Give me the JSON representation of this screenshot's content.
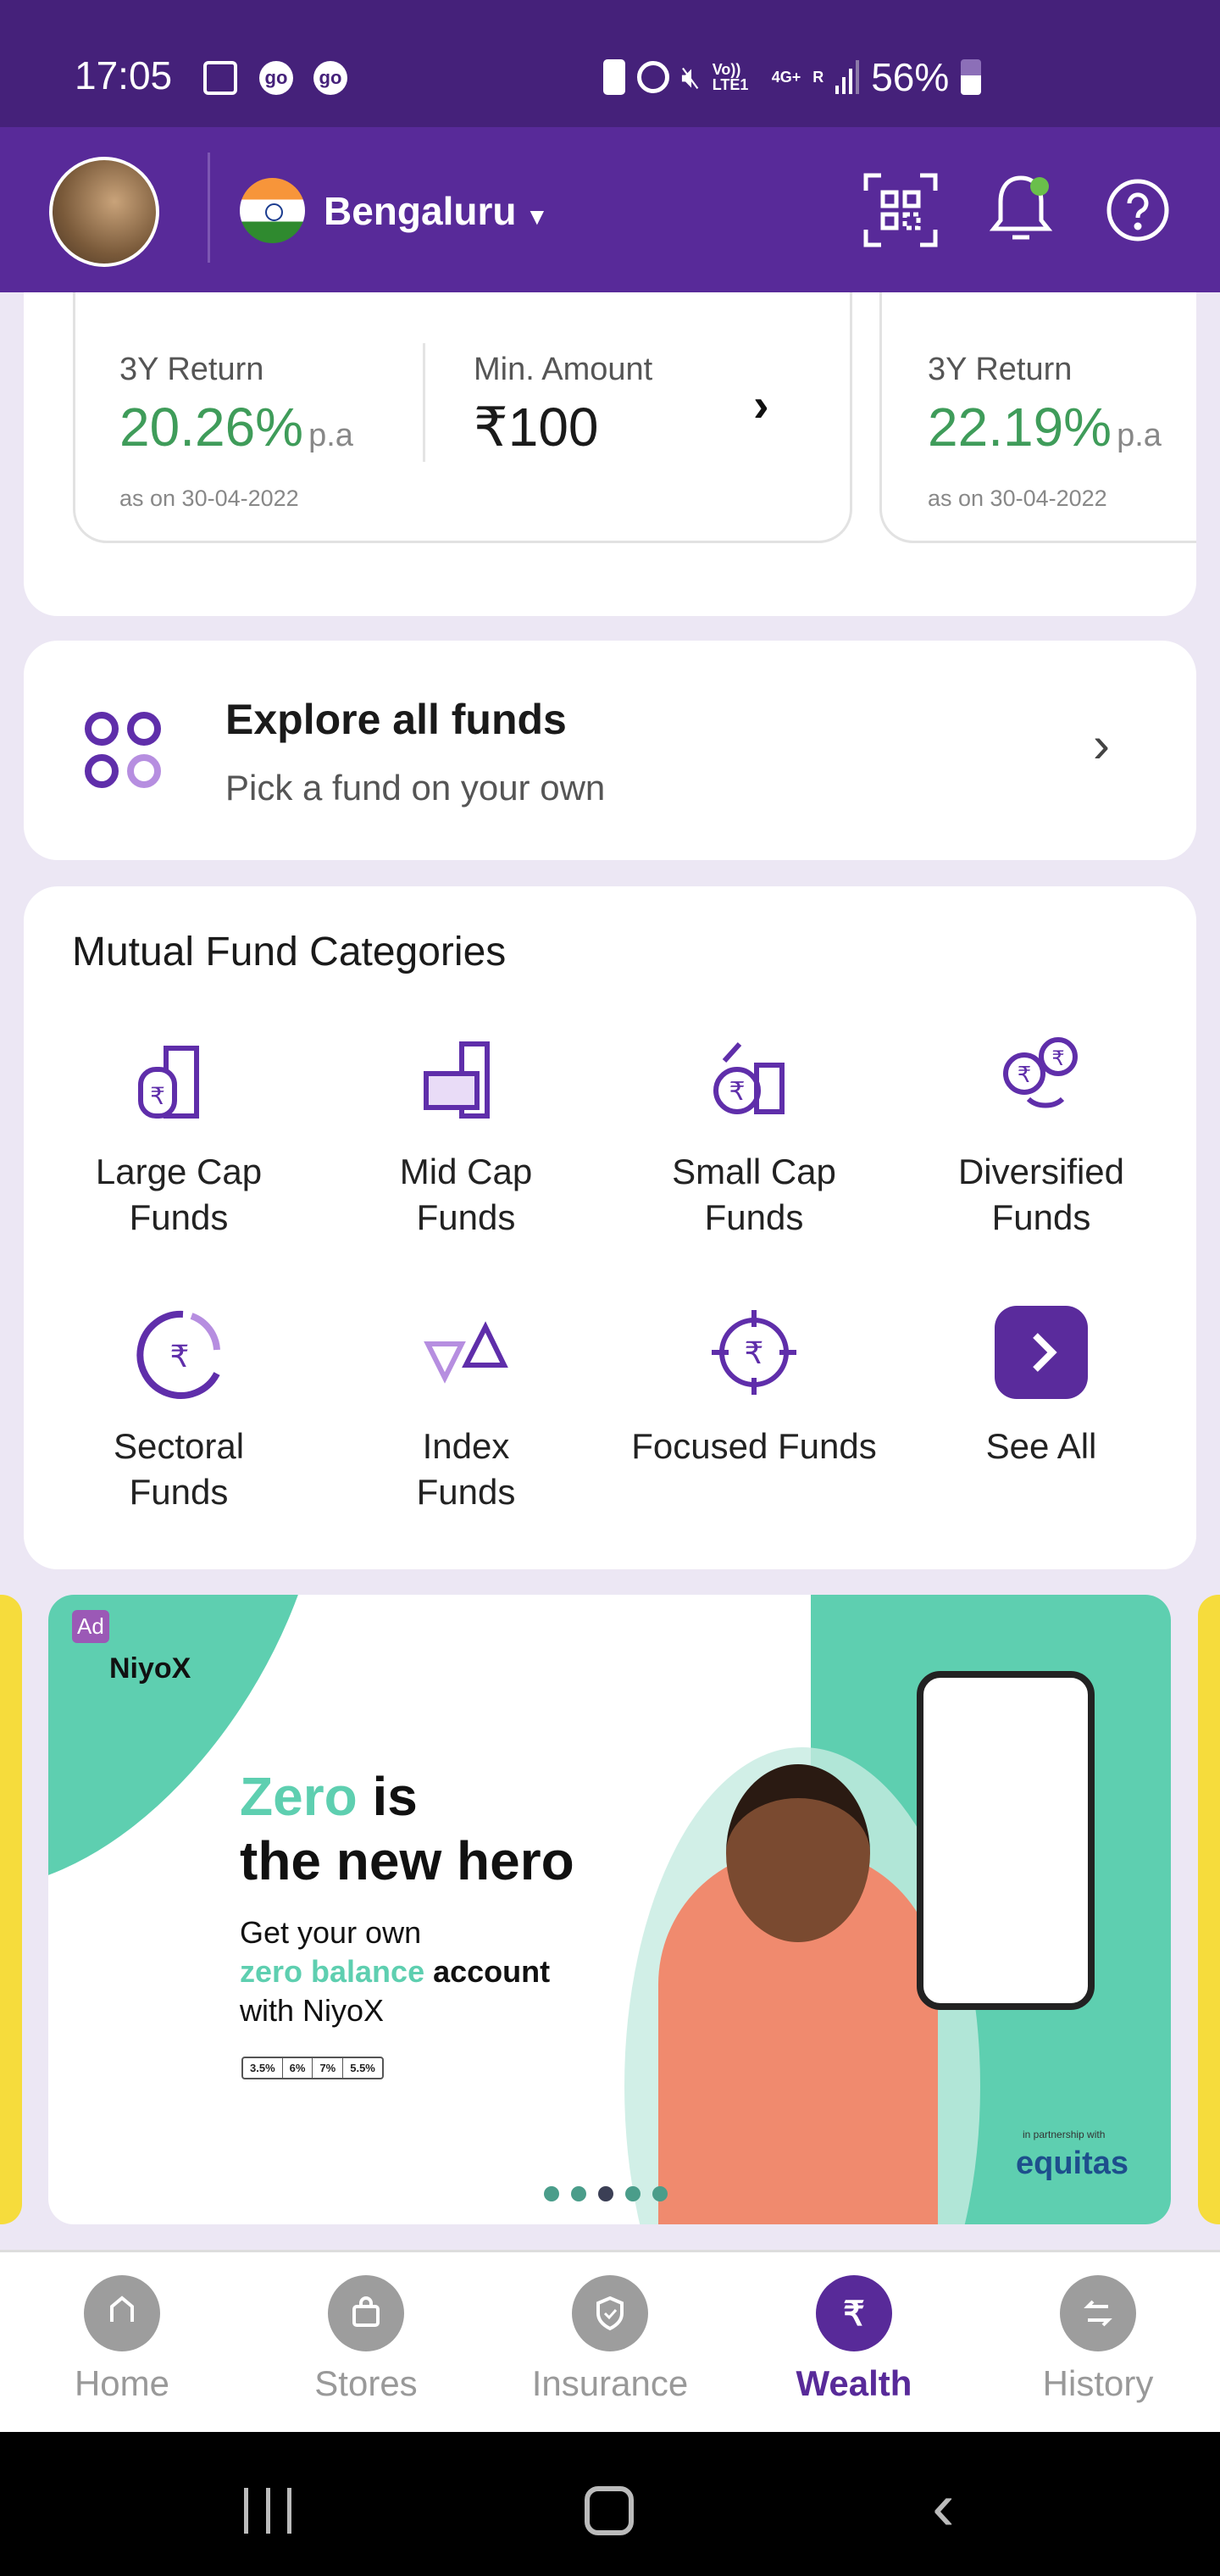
{
  "status_bar": {
    "time": "17:05",
    "notif_icons": [
      "image-icon",
      "go-icon",
      "go-icon"
    ],
    "network": {
      "volte": "Vo)) LTE1",
      "data": "4G+",
      "roaming": "R"
    },
    "battery": "56%"
  },
  "header": {
    "city": "Bengaluru",
    "icons": [
      "qr-scan-icon",
      "bell-icon",
      "help-icon"
    ],
    "notification_dot_color": "#6abf4b"
  },
  "funds": [
    {
      "return_label": "3Y Return",
      "return_value": "20.26%",
      "return_unit": "p.a",
      "as_on": "as on 30-04-2022",
      "min_label": "Min. Amount",
      "min_value": "₹100"
    },
    {
      "return_label": "3Y Return",
      "return_value": "22.19%",
      "return_unit": "p.a",
      "as_on": "as on 30-04-2022"
    }
  ],
  "explore": {
    "title": "Explore all funds",
    "subtitle": "Pick a fund on your own"
  },
  "categories": {
    "title": "Mutual Fund Categories",
    "items": [
      {
        "l1": "Large Cap",
        "l2": "Funds"
      },
      {
        "l1": "Mid Cap",
        "l2": "Funds"
      },
      {
        "l1": "Small Cap",
        "l2": "Funds"
      },
      {
        "l1": "Diversified",
        "l2": "Funds"
      },
      {
        "l1": "Sectoral",
        "l2": "Funds"
      },
      {
        "l1": "Index",
        "l2": "Funds"
      },
      {
        "l1": "Focused Funds",
        "l2": ""
      },
      {
        "l1": "See All",
        "l2": ""
      }
    ]
  },
  "ad": {
    "badge": "Ad",
    "brand": "NiyoX",
    "headline_1": "Zero",
    "headline_2": "is",
    "headline_3": "the new hero",
    "sub_1": "Get your own",
    "sub_2": "zero balance",
    "sub_3": "account",
    "sub_4": "with NiyoX",
    "rates": [
      "3.5%",
      "6%",
      "7%",
      "5.5%"
    ],
    "partner": "in partnership with",
    "partner_brand": "equitas",
    "carousel_total": 5,
    "carousel_active": 3
  },
  "nav": {
    "items": [
      {
        "label": "Home",
        "icon": "home-icon"
      },
      {
        "label": "Stores",
        "icon": "bag-icon"
      },
      {
        "label": "Insurance",
        "icon": "shield-icon"
      },
      {
        "label": "Wealth",
        "icon": "rupee-icon"
      },
      {
        "label": "History",
        "icon": "transfer-icon"
      }
    ],
    "active": "Wealth"
  },
  "colors": {
    "primary": "#582a99",
    "status_bar": "#45217a",
    "green": "#3f9c5a",
    "teal": "#5ecfb0"
  }
}
